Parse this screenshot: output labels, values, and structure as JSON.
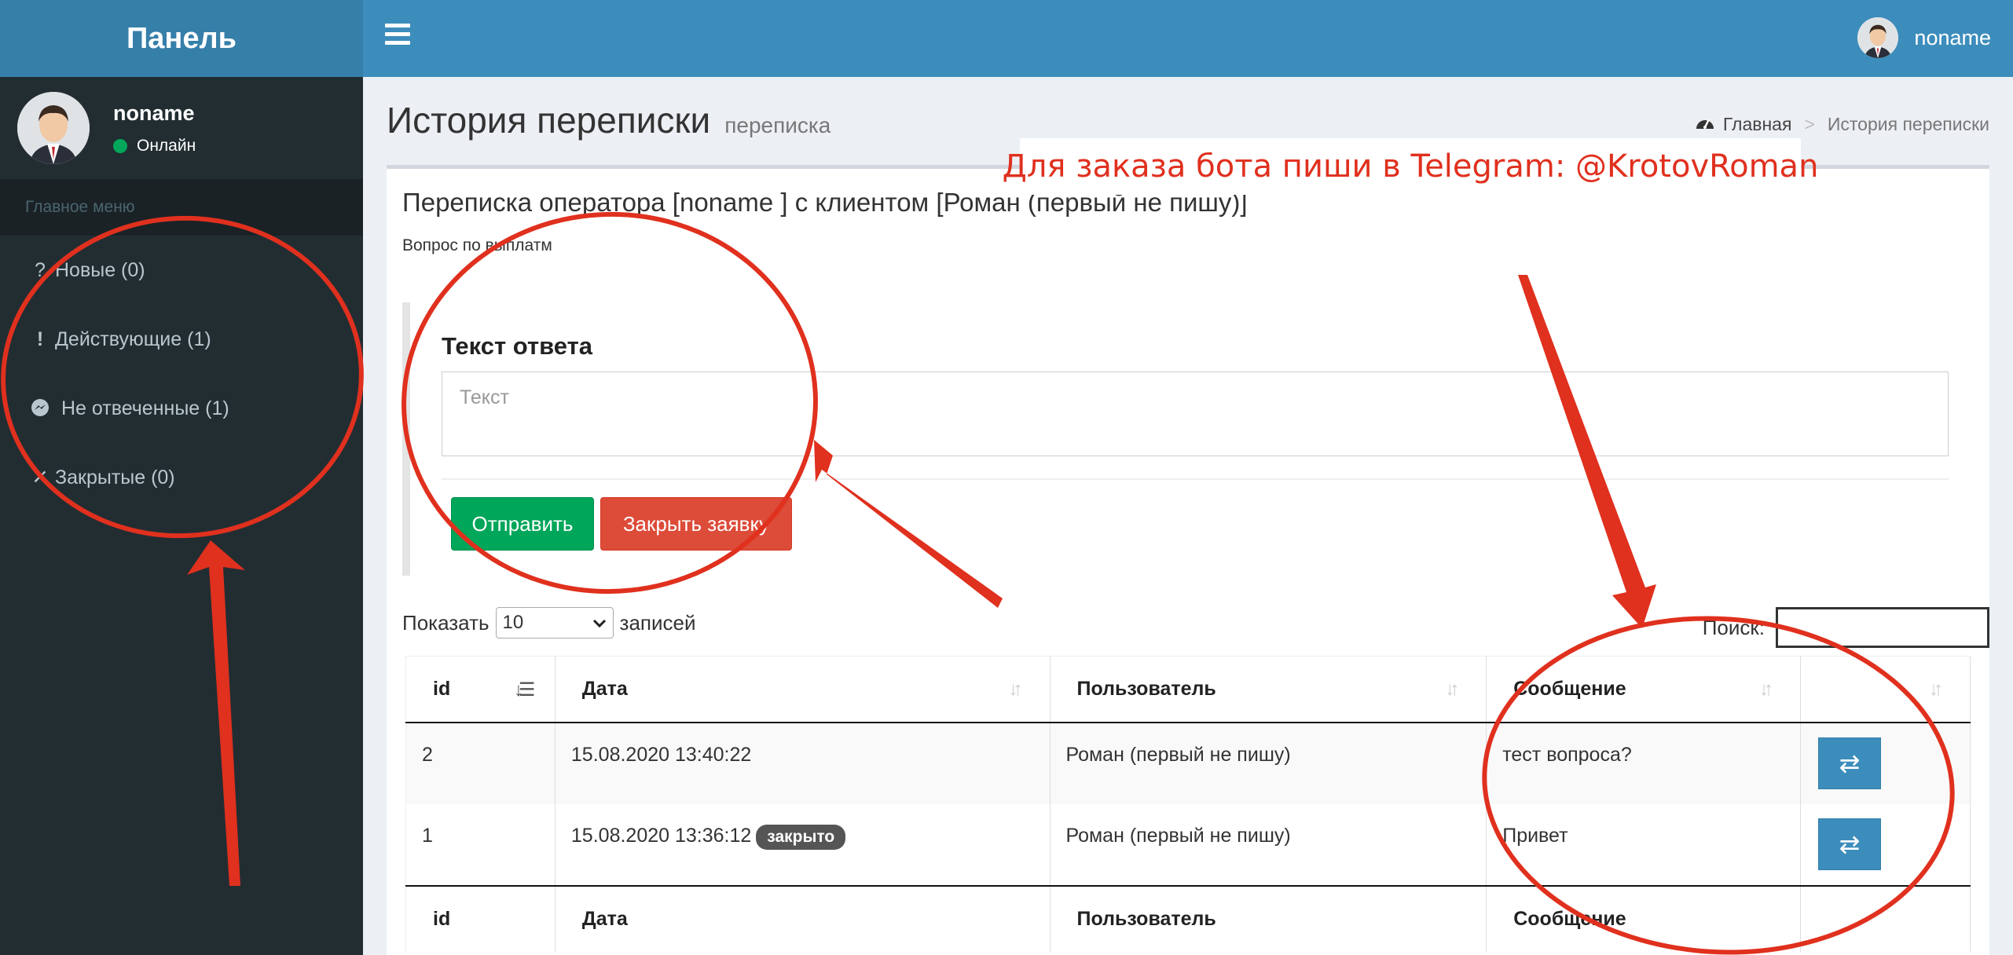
{
  "sidebar": {
    "logo": "Панель",
    "user_name": "noname",
    "user_status": "Онлайн",
    "menu_header": "Главное меню",
    "items": [
      {
        "icon": "question-icon",
        "glyph": "?",
        "label": "Новые (0)"
      },
      {
        "icon": "exclamation-icon",
        "glyph": "!",
        "label": "Действующие (1)"
      },
      {
        "icon": "messenger-icon",
        "glyph": "◔",
        "label": "Не отвеченные (1)"
      },
      {
        "icon": "close-icon",
        "glyph": "✕",
        "label": "Закрытые (0)"
      }
    ]
  },
  "topbar": {
    "user_name": "noname"
  },
  "header": {
    "title": "История переписки",
    "subtitle": "переписка",
    "breadcrumb": {
      "home": "Главная",
      "current": "История переписки"
    }
  },
  "box": {
    "title": "Переписка оператора [noname ] с клиентом [Роман (первый не пишу)]",
    "question": "Вопрос по выплатм",
    "reply_label": "Текст ответа",
    "reply_placeholder": "Текст",
    "send_label": "Отправить",
    "close_label": "Закрыть заявку"
  },
  "datatable": {
    "show_prefix": "Показать",
    "page_size": "10",
    "show_suffix": "записей",
    "search_label": "Поиск:",
    "columns": [
      "id",
      "Дата",
      "Пользователь",
      "Сообщение",
      ""
    ],
    "rows": [
      {
        "id": "2",
        "date": "15.08.2020 13:40:22",
        "badge": "",
        "user": "Роман (первый не пишу)",
        "message": "тест вопроса?"
      },
      {
        "id": "1",
        "date": "15.08.2020 13:36:12",
        "badge": "закрыто",
        "user": "Роман (первый не пишу)",
        "message": "Привет"
      }
    ]
  },
  "annotation": {
    "banner": "Для заказа бота пиши в Telegram: @KrotovRoman",
    "color": "#e0301e"
  },
  "colors": {
    "sidebar_bg": "#222d32",
    "topbar_bg": "#3c8dbc",
    "logo_bg": "#367fa9",
    "success": "#00a65a",
    "danger": "#dd4b39"
  }
}
